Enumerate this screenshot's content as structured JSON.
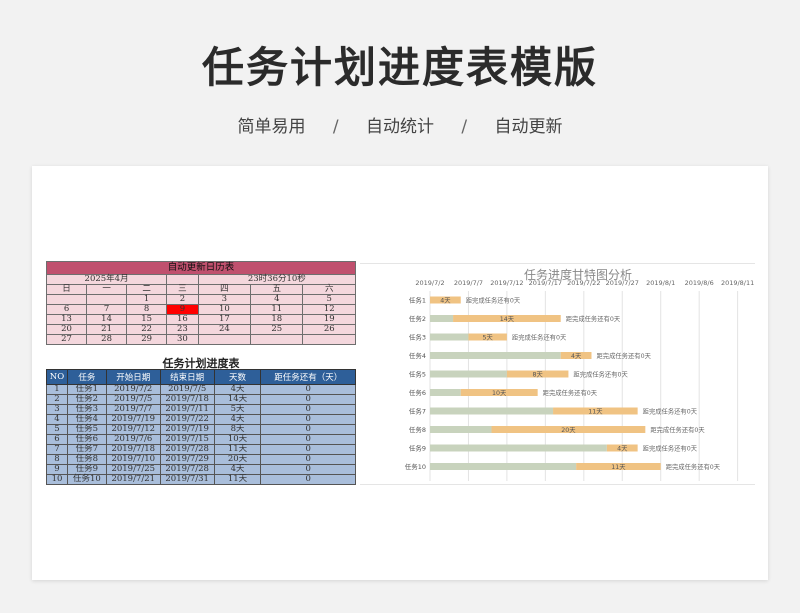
{
  "header": {
    "title": "任务计划进度表模版",
    "tags": [
      "简单易用",
      "自动统计",
      "自动更新"
    ],
    "separator": "/"
  },
  "calendar": {
    "title": "自动更新日历表",
    "month": "2025年4月",
    "clock": "23时36分10秒",
    "weekdays": [
      "日",
      "一",
      "二",
      "三",
      "四",
      "五",
      "六"
    ],
    "weeks": [
      [
        "",
        "",
        "1",
        "2",
        "3",
        "4",
        "5"
      ],
      [
        "6",
        "7",
        "8",
        "9",
        "10",
        "11",
        "12"
      ],
      [
        "13",
        "14",
        "15",
        "16",
        "17",
        "18",
        "19"
      ],
      [
        "20",
        "21",
        "22",
        "23",
        "24",
        "25",
        "26"
      ],
      [
        "27",
        "28",
        "29",
        "30",
        "",
        "",
        ""
      ]
    ],
    "today": "9",
    "today_color": "#ff0000",
    "title_color": "#c0506e",
    "cell_color": "#f4d7dd"
  },
  "task_table": {
    "title": "任务计划进度表",
    "headers": [
      "NO",
      "任务",
      "开始日期",
      "结束日期",
      "天数",
      "距任务还有（天）"
    ],
    "rows": [
      [
        "1",
        "任务1",
        "2019/7/2",
        "2019/7/5",
        "4天",
        "0"
      ],
      [
        "2",
        "任务2",
        "2019/7/5",
        "2019/7/18",
        "14天",
        "0"
      ],
      [
        "3",
        "任务3",
        "2019/7/7",
        "2019/7/11",
        "5天",
        "0"
      ],
      [
        "4",
        "任务4",
        "2019/7/19",
        "2019/7/22",
        "4天",
        "0"
      ],
      [
        "5",
        "任务5",
        "2019/7/12",
        "2019/7/19",
        "8天",
        "0"
      ],
      [
        "6",
        "任务6",
        "2019/7/6",
        "2019/7/15",
        "10天",
        "0"
      ],
      [
        "7",
        "任务7",
        "2019/7/18",
        "2019/7/28",
        "11天",
        "0"
      ],
      [
        "8",
        "任务8",
        "2019/7/10",
        "2019/7/29",
        "20天",
        "0"
      ],
      [
        "9",
        "任务9",
        "2019/7/25",
        "2019/7/28",
        "4天",
        "0"
      ],
      [
        "10",
        "任务10",
        "2019/7/21",
        "2019/7/31",
        "11天",
        "0"
      ]
    ],
    "header_color": "#2e5f99",
    "row_color": "#a9bedb"
  },
  "chart_data": {
    "type": "bar",
    "title": "任务进度甘特图分析",
    "x_ticks": [
      "2019/7/2",
      "2019/7/7",
      "2019/7/12",
      "2019/7/17",
      "2019/7/22",
      "2019/7/27",
      "2019/8/1",
      "2019/8/6",
      "2019/8/11"
    ],
    "xlim": [
      "2019/7/2",
      "2019/8/13"
    ],
    "grid": true,
    "categories": [
      "任务1",
      "任务2",
      "任务3",
      "任务4",
      "任务5",
      "任务6",
      "任务7",
      "任务8",
      "任务9",
      "任务10"
    ],
    "start": [
      "2019/7/2",
      "2019/7/5",
      "2019/7/7",
      "2019/7/19",
      "2019/7/12",
      "2019/7/6",
      "2019/7/18",
      "2019/7/10",
      "2019/7/25",
      "2019/7/21"
    ],
    "duration_labels": [
      "4天",
      "14天",
      "5天",
      "4天",
      "8天",
      "10天",
      "11天",
      "20天",
      "4天",
      "11天"
    ],
    "duration_days": [
      4,
      14,
      5,
      4,
      8,
      10,
      11,
      20,
      4,
      11
    ],
    "remaining_labels": [
      "距完成任务还有0天",
      "距完成任务还有0天",
      "距完成任务还有0天",
      "距完成任务还有0天",
      "距完成任务还有0天",
      "距完成任务还有0天",
      "距完成任务还有0天",
      "距完成任务还有0天",
      "距完成任务还有0天",
      "距完成任务还有0天"
    ],
    "colors": {
      "offset": "#c8d3bd",
      "duration": "#f0c383"
    }
  }
}
